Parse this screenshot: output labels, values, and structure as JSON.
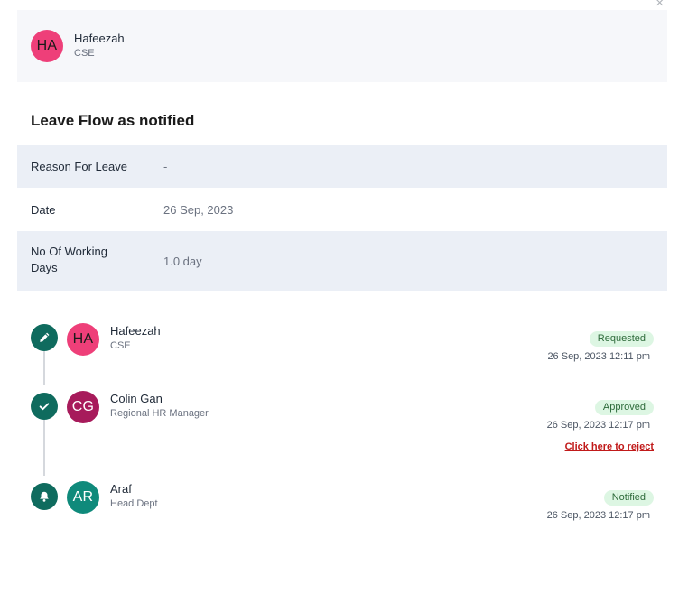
{
  "close_glyph": "×",
  "header": {
    "initials": "HA",
    "name": "Hafeezah",
    "role": "CSE"
  },
  "section_title": "Leave Flow as notified",
  "details": {
    "reason_label": "Reason For Leave",
    "reason_value": "-",
    "date_label": "Date",
    "date_value": "26 Sep, 2023",
    "days_label": "No Of Working Days",
    "days_value": "1.0 day"
  },
  "flow": [
    {
      "icon": "pencil-icon",
      "initials": "HA",
      "name": "Hafeezah",
      "role": "CSE",
      "status": "Requested",
      "time": "26 Sep, 2023 12:11 pm"
    },
    {
      "icon": "check-icon",
      "initials": "CG",
      "name": "Colin Gan",
      "role": "Regional HR Manager",
      "status": "Approved",
      "time": "26 Sep, 2023 12:17 pm",
      "action": "Click here to reject"
    },
    {
      "icon": "bell-icon",
      "initials": "AR",
      "name": "Araf",
      "role": "Head Dept",
      "status": "Notified",
      "time": "26 Sep, 2023 12:17 pm"
    }
  ],
  "colors": {
    "accent_teal": "#0f6b5e",
    "badge_bg": "#ddf6e3",
    "reject_red": "#c11a1a"
  }
}
